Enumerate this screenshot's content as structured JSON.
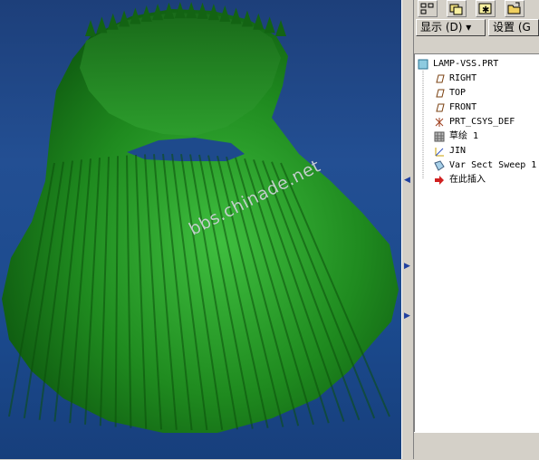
{
  "viewport": {
    "background_top": "#1d3f7a",
    "background_bottom": "#173f7c",
    "model_color": "#1f8a1f",
    "watermark": "bbs.chinade.net"
  },
  "panel": {
    "toolbar_icons": [
      "tree-layout-icon",
      "layers-icon",
      "star-settings-icon",
      "folder-open-icon"
    ],
    "menu": [
      {
        "label": "显示 (D) ▾"
      },
      {
        "label": "设置 (G"
      }
    ],
    "tree": {
      "root": "LAMP-VSS.PRT",
      "items": [
        {
          "label": "RIGHT",
          "icon": "datum-plane-icon"
        },
        {
          "label": "TOP",
          "icon": "datum-plane-icon"
        },
        {
          "label": "FRONT",
          "icon": "datum-plane-icon"
        },
        {
          "label": "PRT_CSYS_DEF",
          "icon": "coordinate-system-icon"
        },
        {
          "label": "草绘 1",
          "icon": "sketch-icon"
        },
        {
          "label": "JIN",
          "icon": "datum-curve-icon"
        },
        {
          "label": "Var Sect Sweep 1",
          "icon": "sweep-feature-icon"
        },
        {
          "label": "在此插入",
          "icon": "insert-here-arrow-icon"
        }
      ]
    }
  }
}
